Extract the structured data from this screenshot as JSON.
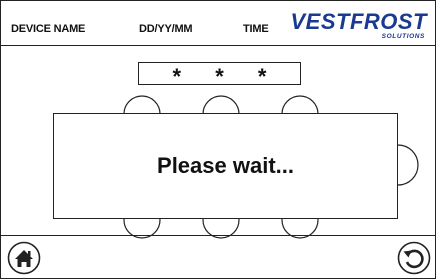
{
  "header": {
    "device_name": "DEVICE NAME",
    "date_format": "DD/YY/MM",
    "time": "TIME",
    "logo_text": "VESTFROST",
    "logo_subtext": "SOLUTIONS"
  },
  "pin_display": "* * * *",
  "dialog": {
    "message": "Please wait..."
  },
  "footer": {
    "home_icon": "home-icon",
    "back_icon": "undo-arrow-icon"
  },
  "colors": {
    "brand": "#1a3a8f",
    "border": "#222222"
  }
}
